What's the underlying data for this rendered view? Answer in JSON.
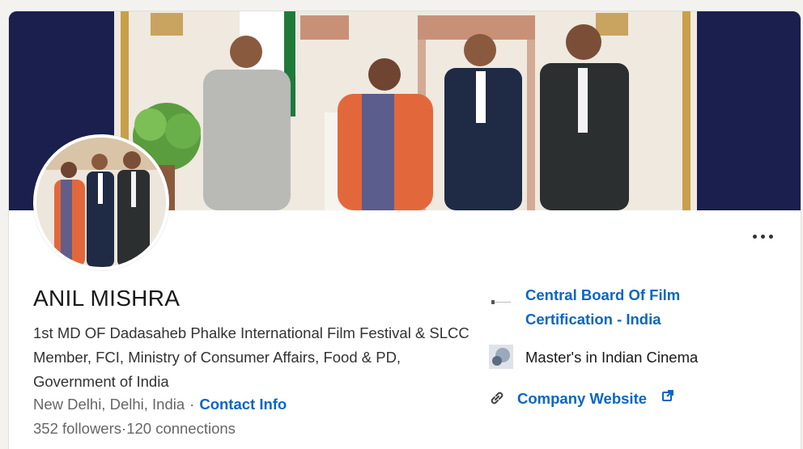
{
  "profile": {
    "name": "ANIL MISHRA",
    "headline": "1st MD OF Dadasaheb Phalke International Film Festival & SLCC Member, FCI, Ministry of Consumer Affairs, Food & PD, Government of India",
    "location": "New Delhi, Delhi, India",
    "contact_info_label": "Contact Info",
    "followers": "352 followers",
    "connections": "120 connections"
  },
  "experience": {
    "organization": "Central Board Of Film Certification - India"
  },
  "education": {
    "school": "Master's in Indian Cinema"
  },
  "website": {
    "label": "Company Website"
  },
  "icons": {
    "more": "more-horizontal-icon",
    "link": "link-chain-icon",
    "external": "external-link-icon"
  },
  "colors": {
    "link": "#0a66c2",
    "text_primary": "#191919",
    "text_secondary": "#666666",
    "cover_background": "#1a1f4d"
  }
}
